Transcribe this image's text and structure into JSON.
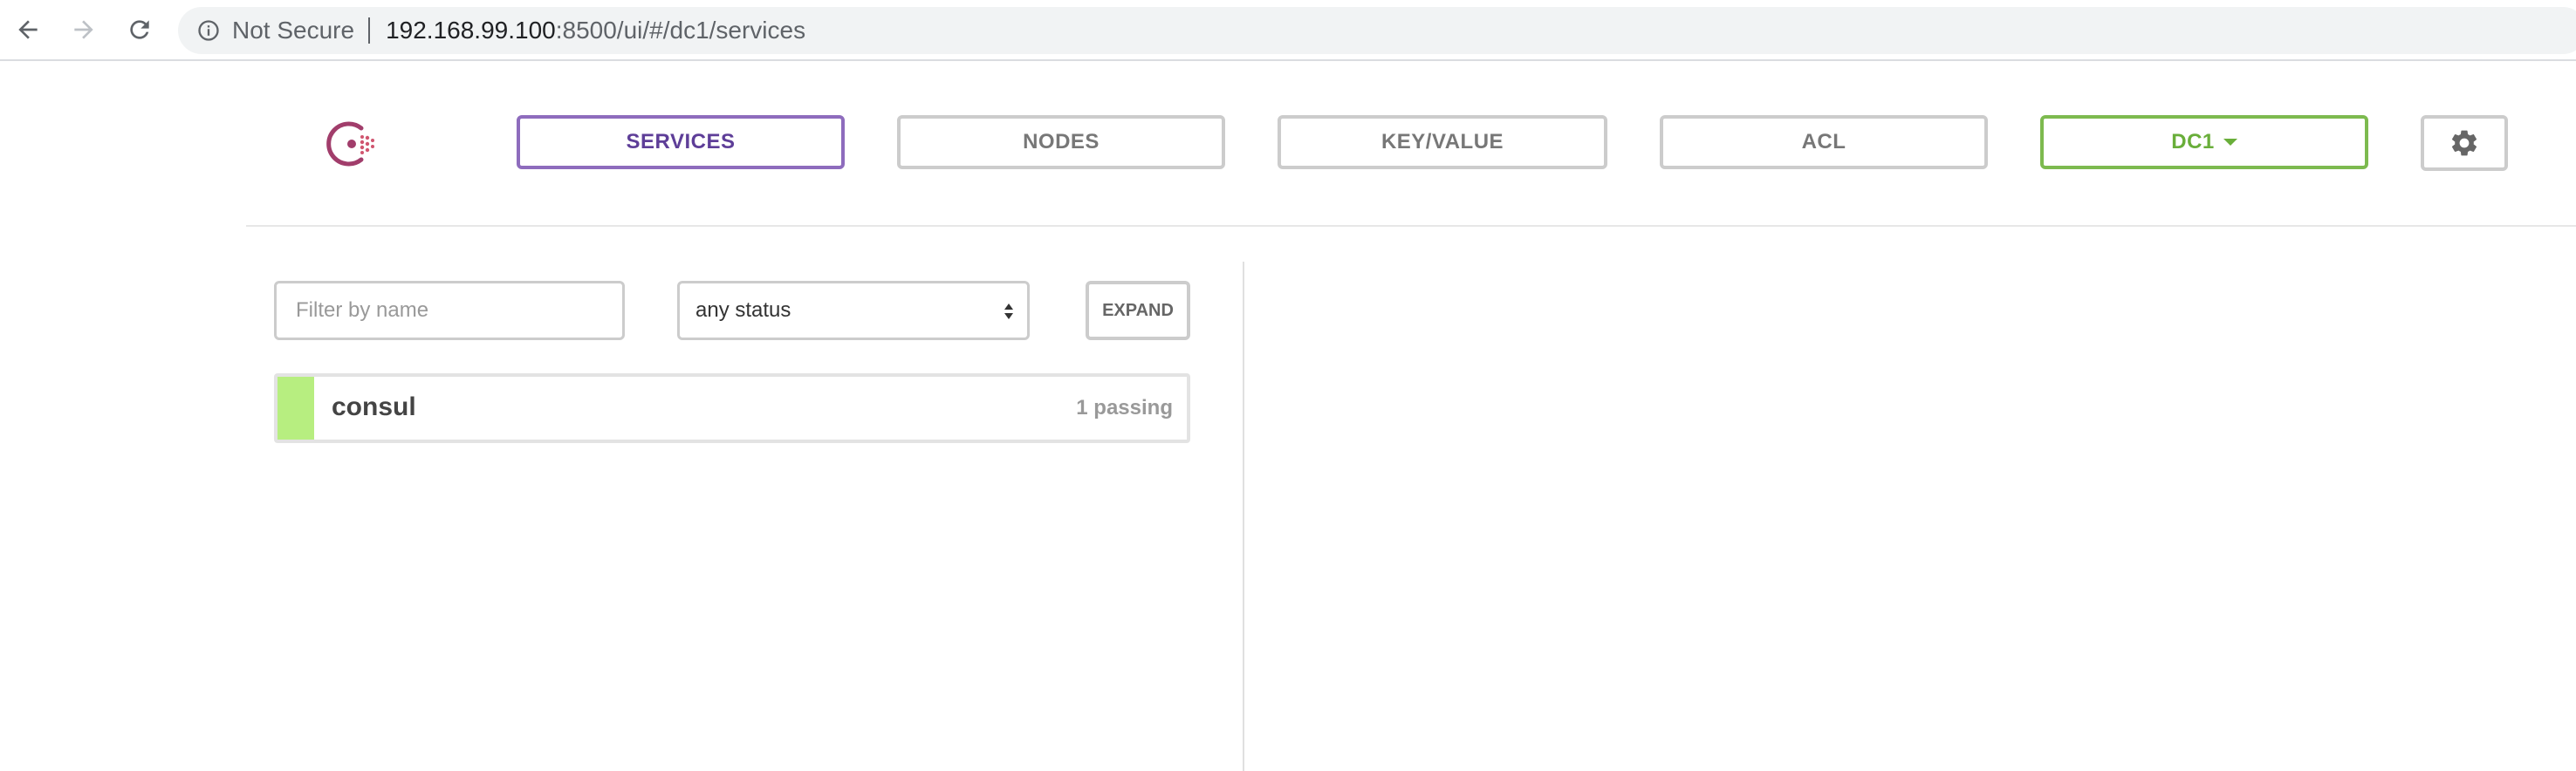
{
  "browser": {
    "security_label": "Not Secure",
    "url_host": "192.168.99.100",
    "url_rest": ":8500/ui/#/dc1/services"
  },
  "nav": {
    "services": "SERVICES",
    "nodes": "NODES",
    "key_value": "KEY/VALUE",
    "acl": "ACL",
    "datacenter": "DC1",
    "active_tab": "SERVICES"
  },
  "filters": {
    "name_placeholder": "Filter by name",
    "name_value": "",
    "status_selected": "any status",
    "expand_label": "EXPAND"
  },
  "services": [
    {
      "name": "consul",
      "checks": "1 passing",
      "status": "passing"
    }
  ],
  "colors": {
    "active_tab": "#8e6cbd",
    "datacenter": "#7dba4f",
    "passing": "#b7ee80",
    "logo": "#a13d6b"
  },
  "icons": {
    "back": "back-arrow-icon",
    "forward": "forward-arrow-icon",
    "reload": "reload-icon",
    "info": "info-icon",
    "settings": "gear-icon",
    "logo": "consul-logo"
  }
}
